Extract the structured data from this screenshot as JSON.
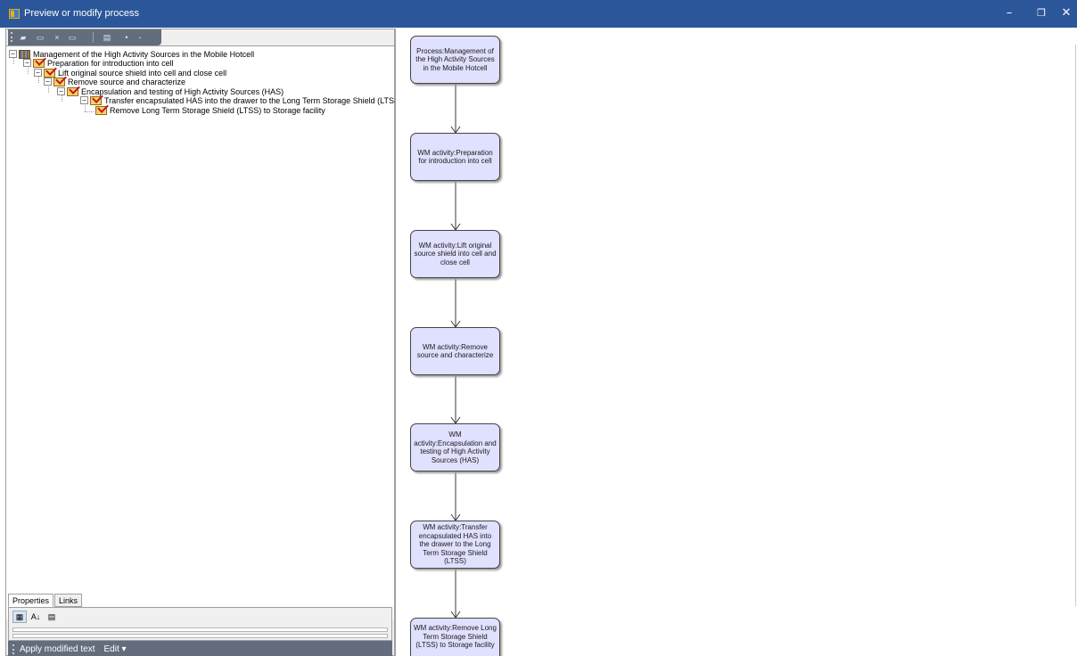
{
  "window": {
    "title": "Preview or modify process",
    "controls": {
      "minimize": "–",
      "restore": "❐",
      "close": "✕"
    }
  },
  "tree": {
    "nodes": [
      {
        "label": "Management of the High Activity Sources in the Mobile Hotcell",
        "icon": "process-icon"
      },
      {
        "label": "Preparation for  introduction into cell",
        "icon": "task-icon"
      },
      {
        "label": "Lift original source shield into cell and close cell",
        "icon": "task-icon"
      },
      {
        "label": "Remove source and characterize",
        "icon": "task-icon"
      },
      {
        "label": "Encapsulation and testing of High Activity Sources (HAS)",
        "icon": "task-icon"
      },
      {
        "label": "Transfer encapsulated HAS into the drawer to the Long Term Storage Shield (LTSS)",
        "icon": "task-icon"
      },
      {
        "label": "Remove Long Term Storage Shield (LTSS) to Storage facility",
        "icon": "task-icon"
      }
    ]
  },
  "bottom_tabs": [
    "Properties",
    "Links"
  ],
  "bottom_toolbar": {
    "apply_label": "Apply modified text",
    "edit_label": "Edit ▾"
  },
  "diagram": {
    "nodes": [
      "Process:Management of the High Activity Sources in the Mobile Hotcell",
      "WM activity:Preparation for  introduction into cell",
      "WM activity:Lift original source shield into cell and close cell",
      "WM activity:Remove source and characterize",
      "WM activity:Encapsulation and testing of High Activity Sources (HAS)",
      "WM activity:Transfer encapsulated HAS into the drawer to the Long Term Storage Shield (LTSS)",
      "WM activity:Remove Long Term Storage Shield (LTSS) to Storage facility"
    ]
  },
  "colors": {
    "titlebar": "#2b579a",
    "toolbar": "#636d7e",
    "node_fill": "#e0e0ff",
    "node_border": "#454545"
  }
}
